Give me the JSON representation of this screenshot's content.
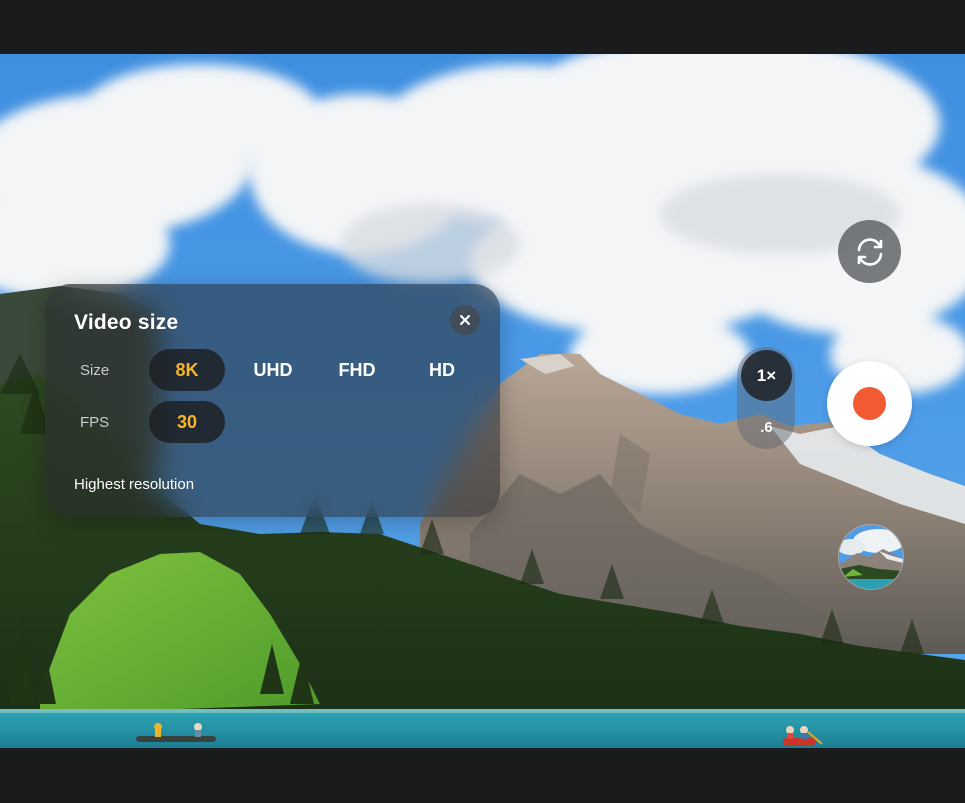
{
  "panel": {
    "title": "Video size",
    "size_label": "Size",
    "fps_label": "FPS",
    "size_options": [
      "8K",
      "UHD",
      "FHD",
      "HD"
    ],
    "selected_size": "8K",
    "fps_options": [
      "30"
    ],
    "selected_fps": "30",
    "description": "Highest resolution",
    "close_icon": "close-icon"
  },
  "controls": {
    "zoom_levels": [
      "1×",
      ".6"
    ],
    "selected_zoom": "1×",
    "flip_icon": "camera-flip-icon",
    "record_icon": "record-icon",
    "gallery_icon": "gallery-thumbnail"
  },
  "colors": {
    "selected_text": "#f7b52b",
    "record_dot": "#f25a33",
    "background_bar": "#1a1b1c"
  }
}
